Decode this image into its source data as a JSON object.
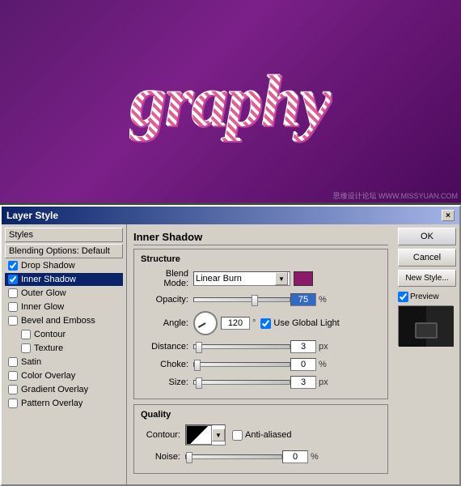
{
  "canvas": {
    "text": "graphy"
  },
  "dialog": {
    "title": "Layer Style",
    "close_label": "×",
    "left_panel": {
      "styles_label": "Styles",
      "blending_label": "Blending Options: Default",
      "items": [
        {
          "label": "Drop Shadow",
          "checked": true,
          "selected": false,
          "indent": false
        },
        {
          "label": "Inner Shadow",
          "checked": true,
          "selected": true,
          "indent": false
        },
        {
          "label": "Outer Glow",
          "checked": false,
          "selected": false,
          "indent": false
        },
        {
          "label": "Inner Glow",
          "checked": false,
          "selected": false,
          "indent": false
        },
        {
          "label": "Bevel and Emboss",
          "checked": false,
          "selected": false,
          "indent": false
        },
        {
          "label": "Contour",
          "checked": false,
          "selected": false,
          "indent": true
        },
        {
          "label": "Texture",
          "checked": false,
          "selected": false,
          "indent": true
        },
        {
          "label": "Satin",
          "checked": false,
          "selected": false,
          "indent": false
        },
        {
          "label": "Color Overlay",
          "checked": false,
          "selected": false,
          "indent": false
        },
        {
          "label": "Gradient Overlay",
          "checked": false,
          "selected": false,
          "indent": false
        },
        {
          "label": "Pattern Overlay",
          "checked": false,
          "selected": false,
          "indent": false
        }
      ]
    },
    "center": {
      "section_title": "Inner Shadow",
      "structure_label": "Structure",
      "blend_mode_label": "Blend Mode:",
      "blend_mode_value": "Linear Burn",
      "opacity_label": "Opacity:",
      "opacity_value": "75",
      "opacity_unit": "%",
      "angle_label": "Angle:",
      "angle_value": "120",
      "angle_unit": "°",
      "use_global_light": "Use Global Light",
      "distance_label": "Distance:",
      "distance_value": "3",
      "distance_unit": "px",
      "choke_label": "Choke:",
      "choke_value": "0",
      "choke_unit": "%",
      "size_label": "Size:",
      "size_value": "3",
      "size_unit": "px",
      "quality_label": "Quality",
      "contour_label": "Contour:",
      "anti_aliased_label": "Anti-aliased",
      "noise_label": "Noise:",
      "noise_value": "0",
      "noise_unit": "%"
    },
    "right_panel": {
      "ok_label": "OK",
      "cancel_label": "Cancel",
      "new_style_label": "New Style...",
      "preview_label": "Preview"
    }
  },
  "watermark": "思缘设计论坛 WWW.MISSYUAN.COM"
}
